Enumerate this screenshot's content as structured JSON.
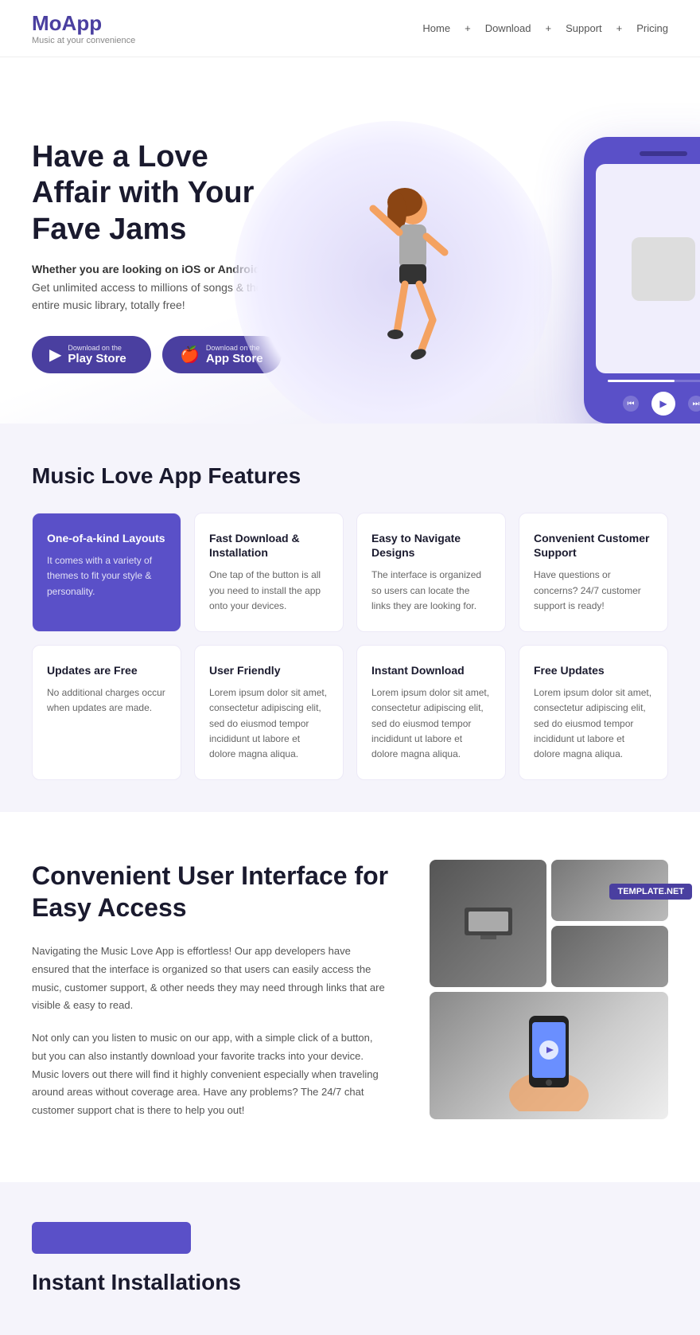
{
  "nav": {
    "brand": "MoApp",
    "tagline": "Music at your convenience",
    "links": [
      "Home",
      "Download",
      "Support",
      "Pricing"
    ]
  },
  "hero": {
    "title": "Have a Love Affair with Your Fave Jams",
    "subtitle_line1": "Whether you are looking on iOS or Android",
    "subtitle_body": "Get unlimited access to millions of songs & the entire music library, totally free!",
    "btn_play_top": "Download on the",
    "btn_play_main": "Play Store",
    "btn_app_top": "Download on the",
    "btn_app_main": "App Store"
  },
  "features": {
    "section_title": "Music Love App Features",
    "row1": [
      {
        "title": "One-of-a-kind Layouts",
        "desc": "It comes with a variety of themes to fit your style & personality.",
        "highlighted": true
      },
      {
        "title": "Fast Download & Installation",
        "desc": "One tap of the button is all you need to install the app onto your devices.",
        "highlighted": false
      },
      {
        "title": "Easy to Navigate Designs",
        "desc": "The interface is organized so users can locate the links they are looking for.",
        "highlighted": false
      },
      {
        "title": "Convenient Customer Support",
        "desc": "Have questions or concerns? 24/7 customer support is ready!",
        "highlighted": false
      }
    ],
    "row2": [
      {
        "title": "Updates are Free",
        "desc": "No additional charges occur when updates are made.",
        "highlighted": false
      },
      {
        "title": "User Friendly",
        "desc": "Lorem ipsum dolor sit amet, consectetur adipiscing elit, sed do eiusmod tempor incididunt ut labore et dolore magna aliqua.",
        "highlighted": false
      },
      {
        "title": "Instant Download",
        "desc": "Lorem ipsum dolor sit amet, consectetur adipiscing elit, sed do eiusmod tempor incididunt ut labore et dolore magna aliqua.",
        "highlighted": false
      },
      {
        "title": "Free Updates",
        "desc": "Lorem ipsum dolor sit amet, consectetur adipiscing elit, sed do eiusmod tempor incididunt ut labore et dolore magna aliqua.",
        "highlighted": false
      }
    ]
  },
  "about": {
    "title": "Convenient User Interface for Easy Access",
    "text1": "Navigating the Music Love App is effortless!  Our app developers have ensured that the interface is organized so that users can easily access the music, customer support, & other needs they may need through links that are visible & easy to read.",
    "text2": "Not only can you listen to music on our app, with a simple click of a button, but you can also instantly download your favorite tracks into your device. Music lovers out there will find it highly convenient especially when traveling around areas without coverage area.  Have any problems?  The 24/7 chat customer support chat is there to help you out!"
  },
  "bottom": {
    "title": "Instant Installations"
  },
  "template_badge": "TEMPLATE.NET"
}
